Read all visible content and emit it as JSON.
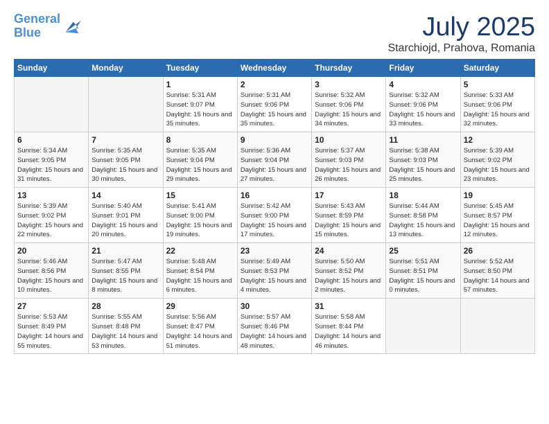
{
  "logo": {
    "line1": "General",
    "line2": "Blue"
  },
  "title": "July 2025",
  "subtitle": "Starchiojd, Prahova, Romania",
  "days_header": [
    "Sunday",
    "Monday",
    "Tuesday",
    "Wednesday",
    "Thursday",
    "Friday",
    "Saturday"
  ],
  "weeks": [
    [
      {
        "day": "",
        "info": ""
      },
      {
        "day": "",
        "info": ""
      },
      {
        "day": "1",
        "info": "Sunrise: 5:31 AM\nSunset: 9:07 PM\nDaylight: 15 hours and 35 minutes."
      },
      {
        "day": "2",
        "info": "Sunrise: 5:31 AM\nSunset: 9:06 PM\nDaylight: 15 hours and 35 minutes."
      },
      {
        "day": "3",
        "info": "Sunrise: 5:32 AM\nSunset: 9:06 PM\nDaylight: 15 hours and 34 minutes."
      },
      {
        "day": "4",
        "info": "Sunrise: 5:32 AM\nSunset: 9:06 PM\nDaylight: 15 hours and 33 minutes."
      },
      {
        "day": "5",
        "info": "Sunrise: 5:33 AM\nSunset: 9:06 PM\nDaylight: 15 hours and 32 minutes."
      }
    ],
    [
      {
        "day": "6",
        "info": "Sunrise: 5:34 AM\nSunset: 9:05 PM\nDaylight: 15 hours and 31 minutes."
      },
      {
        "day": "7",
        "info": "Sunrise: 5:35 AM\nSunset: 9:05 PM\nDaylight: 15 hours and 30 minutes."
      },
      {
        "day": "8",
        "info": "Sunrise: 5:35 AM\nSunset: 9:04 PM\nDaylight: 15 hours and 29 minutes."
      },
      {
        "day": "9",
        "info": "Sunrise: 5:36 AM\nSunset: 9:04 PM\nDaylight: 15 hours and 27 minutes."
      },
      {
        "day": "10",
        "info": "Sunrise: 5:37 AM\nSunset: 9:03 PM\nDaylight: 15 hours and 26 minutes."
      },
      {
        "day": "11",
        "info": "Sunrise: 5:38 AM\nSunset: 9:03 PM\nDaylight: 15 hours and 25 minutes."
      },
      {
        "day": "12",
        "info": "Sunrise: 5:39 AM\nSunset: 9:02 PM\nDaylight: 15 hours and 23 minutes."
      }
    ],
    [
      {
        "day": "13",
        "info": "Sunrise: 5:39 AM\nSunset: 9:02 PM\nDaylight: 15 hours and 22 minutes."
      },
      {
        "day": "14",
        "info": "Sunrise: 5:40 AM\nSunset: 9:01 PM\nDaylight: 15 hours and 20 minutes."
      },
      {
        "day": "15",
        "info": "Sunrise: 5:41 AM\nSunset: 9:00 PM\nDaylight: 15 hours and 19 minutes."
      },
      {
        "day": "16",
        "info": "Sunrise: 5:42 AM\nSunset: 9:00 PM\nDaylight: 15 hours and 17 minutes."
      },
      {
        "day": "17",
        "info": "Sunrise: 5:43 AM\nSunset: 8:59 PM\nDaylight: 15 hours and 15 minutes."
      },
      {
        "day": "18",
        "info": "Sunrise: 5:44 AM\nSunset: 8:58 PM\nDaylight: 15 hours and 13 minutes."
      },
      {
        "day": "19",
        "info": "Sunrise: 5:45 AM\nSunset: 8:57 PM\nDaylight: 15 hours and 12 minutes."
      }
    ],
    [
      {
        "day": "20",
        "info": "Sunrise: 5:46 AM\nSunset: 8:56 PM\nDaylight: 15 hours and 10 minutes."
      },
      {
        "day": "21",
        "info": "Sunrise: 5:47 AM\nSunset: 8:55 PM\nDaylight: 15 hours and 8 minutes."
      },
      {
        "day": "22",
        "info": "Sunrise: 5:48 AM\nSunset: 8:54 PM\nDaylight: 15 hours and 6 minutes."
      },
      {
        "day": "23",
        "info": "Sunrise: 5:49 AM\nSunset: 8:53 PM\nDaylight: 15 hours and 4 minutes."
      },
      {
        "day": "24",
        "info": "Sunrise: 5:50 AM\nSunset: 8:52 PM\nDaylight: 15 hours and 2 minutes."
      },
      {
        "day": "25",
        "info": "Sunrise: 5:51 AM\nSunset: 8:51 PM\nDaylight: 15 hours and 0 minutes."
      },
      {
        "day": "26",
        "info": "Sunrise: 5:52 AM\nSunset: 8:50 PM\nDaylight: 14 hours and 57 minutes."
      }
    ],
    [
      {
        "day": "27",
        "info": "Sunrise: 5:53 AM\nSunset: 8:49 PM\nDaylight: 14 hours and 55 minutes."
      },
      {
        "day": "28",
        "info": "Sunrise: 5:55 AM\nSunset: 8:48 PM\nDaylight: 14 hours and 53 minutes."
      },
      {
        "day": "29",
        "info": "Sunrise: 5:56 AM\nSunset: 8:47 PM\nDaylight: 14 hours and 51 minutes."
      },
      {
        "day": "30",
        "info": "Sunrise: 5:57 AM\nSunset: 8:46 PM\nDaylight: 14 hours and 48 minutes."
      },
      {
        "day": "31",
        "info": "Sunrise: 5:58 AM\nSunset: 8:44 PM\nDaylight: 14 hours and 46 minutes."
      },
      {
        "day": "",
        "info": ""
      },
      {
        "day": "",
        "info": ""
      }
    ]
  ]
}
